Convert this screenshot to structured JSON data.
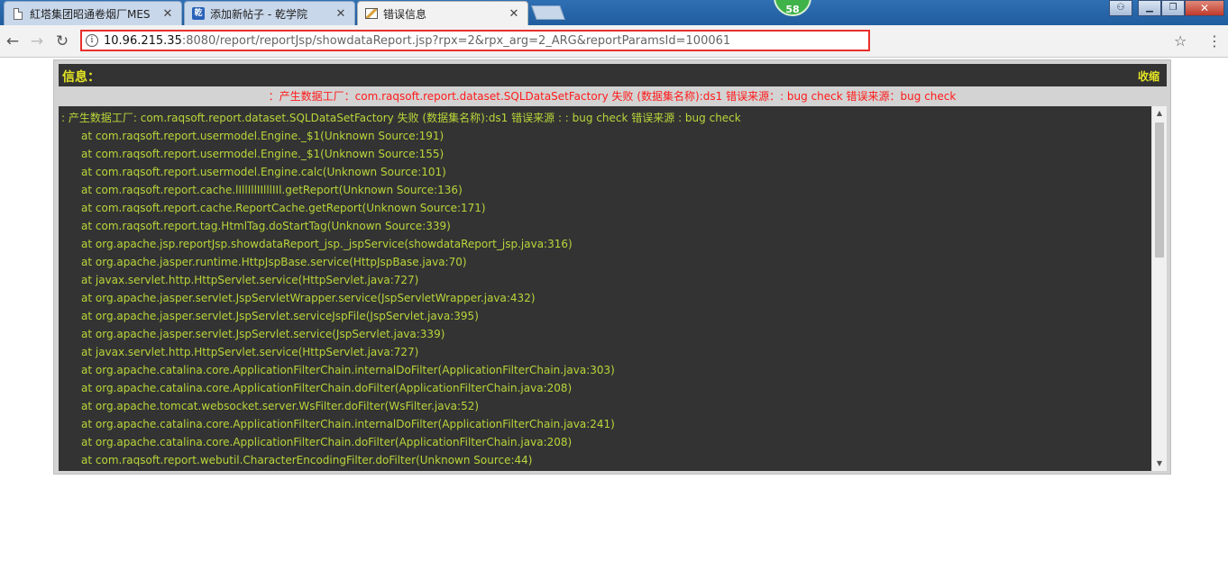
{
  "browser": {
    "tabs": [
      {
        "title": "紅塔集团昭通卷烟厂MES",
        "icon": "document-icon"
      },
      {
        "title": "添加新帖子 - 乾学院",
        "icon": "qian-favicon"
      },
      {
        "title": "错误信息",
        "icon": "image-icon"
      }
    ],
    "badge_count": "58",
    "address": {
      "host": "10.96.215.35",
      "rest": ":8080/report/reportJsp/showdataReport.jsp?rpx=2&rpx_arg=2_ARG&reportParamsId=100061"
    },
    "accent_color": "#e8302d"
  },
  "panel": {
    "title": "信息：",
    "collapse_label": "收缩",
    "summary": "：产生数据工厂：com.raqsoft.report.dataset.SQLDataSetFactory 失败 (数据集名称):ds1 错误来源：: bug check 错误来源：bug check",
    "log_lines": [
      ": 产生数据工厂: com.raqsoft.report.dataset.SQLDataSetFactory 失败 (数据集名称):ds1 错误来源 : : bug check 错误来源 : bug check",
      "at com.raqsoft.report.usermodel.Engine._$1(Unknown Source:191)",
      "at com.raqsoft.report.usermodel.Engine._$1(Unknown Source:155)",
      "at com.raqsoft.report.usermodel.Engine.calc(Unknown Source:101)",
      "at com.raqsoft.report.cache.lIllIllIIlllIIl.getReport(Unknown Source:136)",
      "at com.raqsoft.report.cache.ReportCache.getReport(Unknown Source:171)",
      "at com.raqsoft.report.tag.HtmlTag.doStartTag(Unknown Source:339)",
      "at org.apache.jsp.reportJsp.showdataReport_jsp._jspService(showdataReport_jsp.java:316)",
      "at org.apache.jasper.runtime.HttpJspBase.service(HttpJspBase.java:70)",
      "at javax.servlet.http.HttpServlet.service(HttpServlet.java:727)",
      "at org.apache.jasper.servlet.JspServletWrapper.service(JspServletWrapper.java:432)",
      "at org.apache.jasper.servlet.JspServlet.serviceJspFile(JspServlet.java:395)",
      "at org.apache.jasper.servlet.JspServlet.service(JspServlet.java:339)",
      "at javax.servlet.http.HttpServlet.service(HttpServlet.java:727)",
      "at org.apache.catalina.core.ApplicationFilterChain.internalDoFilter(ApplicationFilterChain.java:303)",
      "at org.apache.catalina.core.ApplicationFilterChain.doFilter(ApplicationFilterChain.java:208)",
      "at org.apache.tomcat.websocket.server.WsFilter.doFilter(WsFilter.java:52)",
      "at org.apache.catalina.core.ApplicationFilterChain.internalDoFilter(ApplicationFilterChain.java:241)",
      "at org.apache.catalina.core.ApplicationFilterChain.doFilter(ApplicationFilterChain.java:208)",
      "at com.raqsoft.report.webutil.CharacterEncodingFilter.doFilter(Unknown Source:44)"
    ],
    "colors": {
      "header_text": "#e5e525",
      "summary_text": "#ff1a1a",
      "log_text": "#b8d63a",
      "log_bg": "#333333"
    }
  }
}
